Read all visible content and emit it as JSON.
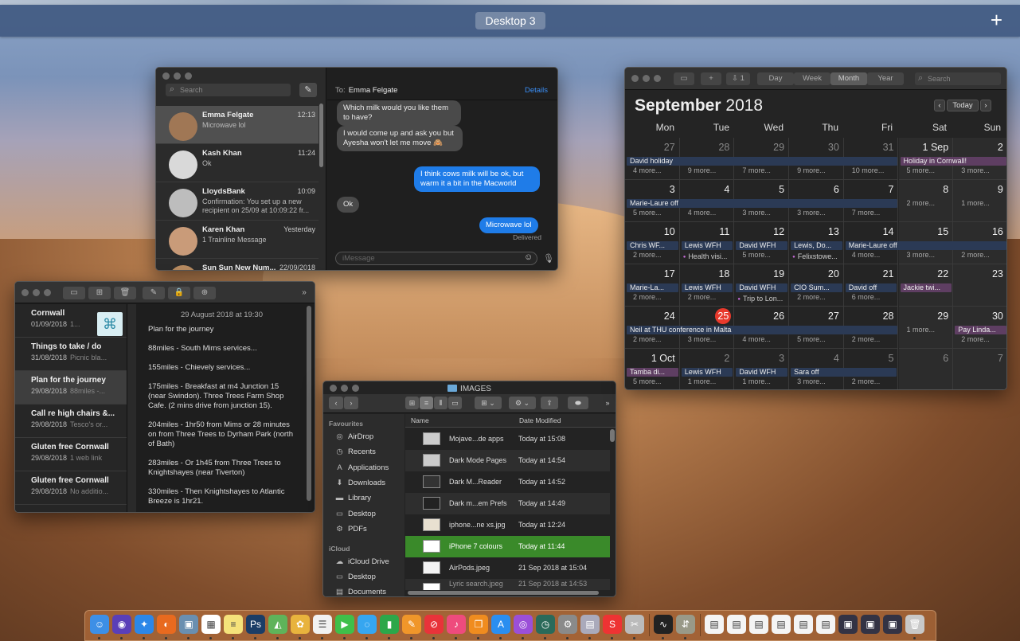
{
  "mission_control": {
    "desktop_label": "Desktop 3",
    "add_label": "+"
  },
  "messages": {
    "search_placeholder": "Search",
    "to_label": "To:",
    "to_name": "Emma Felgate",
    "details": "Details",
    "conversations": [
      {
        "name": "Emma Felgate",
        "time": "12:13",
        "preview": "Microwave lol"
      },
      {
        "name": "Kash Khan",
        "time": "11:24",
        "preview": "Ok"
      },
      {
        "name": "LloydsBank",
        "time": "10:09",
        "preview": "Confirmation: You set up a new recipient on 25/09 at 10:09:22 fr..."
      },
      {
        "name": "Karen Khan",
        "time": "Yesterday",
        "preview": "1 Trainline Message"
      },
      {
        "name": "Sun Sun New Num...",
        "time": "22/09/2018",
        "preview": ""
      }
    ],
    "bubbles": [
      {
        "dir": "in",
        "text": "Which milk would you like them to have?"
      },
      {
        "dir": "in",
        "text": "I would come up and ask you but Ayesha won't let me move 🙈"
      },
      {
        "dir": "out",
        "text": "I think cows milk will be ok, but warm it a bit in the Macworld"
      },
      {
        "dir": "in",
        "text": "Ok"
      },
      {
        "dir": "out",
        "text": "Microwave lol"
      }
    ],
    "delivered": "Delivered",
    "input_placeholder": "iMessage"
  },
  "notes": {
    "items": [
      {
        "title": "Cornwall",
        "date": "01/09/2018",
        "snippet": "1..."
      },
      {
        "title": "Things to take / do",
        "date": "31/08/2018",
        "snippet": "Picnic bla..."
      },
      {
        "title": "Plan for the journey",
        "date": "29/08/2018",
        "snippet": "88miles -..."
      },
      {
        "title": "Call re high chairs &...",
        "date": "29/08/2018",
        "snippet": "Tesco's or..."
      },
      {
        "title": "Gluten free Cornwall",
        "date": "29/08/2018",
        "snippet": "1 web link"
      },
      {
        "title": "Gluten free Cornwall",
        "date": "29/08/2018",
        "snippet": "No additio..."
      }
    ],
    "date": "29 August 2018 at 19:30",
    "paragraphs": [
      "Plan for the journey",
      "88miles - South Mims services...",
      "155miles - Chievely services...",
      "175miles - Breakfast at m4 Junction 15 (near Swindon). Three Trees Farm Shop Cafe. (2 mins drive from junction 15).",
      "204miles - 1hr50 from Mims or 28 minutes on from Three Trees to Dyrham Park (north of Bath)",
      "283miles - Or 1h45 from Three Trees to Knightshayes (near Tiverton)",
      "330miles - Then Knightshayes to Atlantic Breeze is 1hr21."
    ]
  },
  "finder": {
    "title": "IMAGES",
    "favourites_label": "Favourites",
    "favourites": [
      "AirDrop",
      "Recents",
      "Applications",
      "Downloads",
      "Library",
      "Desktop",
      "PDFs"
    ],
    "icloud_label": "iCloud",
    "icloud": [
      "iCloud Drive",
      "Desktop",
      "Documents"
    ],
    "col_name": "Name",
    "col_date": "Date Modified",
    "files": [
      {
        "name": "Mojave...de apps",
        "date": "Today at 15:08"
      },
      {
        "name": "Dark Mode Pages",
        "date": "Today at 14:54"
      },
      {
        "name": "Dark M...Reader",
        "date": "Today at 14:52"
      },
      {
        "name": "Dark m...em Prefs",
        "date": "Today at 14:49"
      },
      {
        "name": "iphone...ne xs.jpg",
        "date": "Today at 12:24"
      },
      {
        "name": "iPhone 7 colours",
        "date": "Today at 11:44"
      },
      {
        "name": "AirPods.jpeg",
        "date": "21 Sep 2018 at 15:04"
      },
      {
        "name": "Lyric search.jpeg",
        "date": "21 Sep 2018 at 14:53"
      }
    ]
  },
  "calendar": {
    "month": "September",
    "year": "2018",
    "views": [
      "Day",
      "Week",
      "Month",
      "Year"
    ],
    "active_view": "Month",
    "search_placeholder": "Search",
    "today_label": "Today",
    "badge": "1",
    "weekdays": [
      "Mon",
      "Tue",
      "Wed",
      "Thu",
      "Fri",
      "Sat",
      "Sun"
    ],
    "weeks": [
      [
        "27",
        "28",
        "29",
        "30",
        "31",
        "1 Sep",
        "2"
      ],
      [
        "3",
        "4",
        "5",
        "6",
        "7",
        "8",
        "9"
      ],
      [
        "10",
        "11",
        "12",
        "13",
        "14",
        "15",
        "16"
      ],
      [
        "17",
        "18",
        "19",
        "20",
        "21",
        "22",
        "23"
      ],
      [
        "24",
        "25",
        "26",
        "27",
        "28",
        "29",
        "30"
      ],
      [
        "1 Oct",
        "2",
        "3",
        "4",
        "5",
        "6",
        "7"
      ]
    ],
    "today_text": "25",
    "events": {
      "david_holiday": "David holiday",
      "holiday_cornwall": "Holiday in Cornwall!",
      "marie_laure_off": "Marie-Laure off",
      "chris_wf": "Chris WF...",
      "lewis_wfh": "Lewis WFH",
      "david_wfh": "David WFH",
      "lewis_do": "Lewis, Do...",
      "marie_laure_off2": "Marie-Laure off",
      "health_visit": "Health visi...",
      "felixstowe": "Felixstowe...",
      "marie_la": "Marie-La...",
      "cio_sum": "CIO Sum...",
      "david_off": "David off",
      "jackie": "Jackie twi...",
      "trip_london": "Trip to Lon...",
      "neil": "Neil at THU conference in Malta",
      "pay_linda": "Pay Linda...",
      "tamba": "Tamba di...",
      "sara_off": "Sara off"
    },
    "more": {
      "w1": [
        "4 more...",
        "9 more...",
        "7 more...",
        "9 more...",
        "10 more...",
        "5 more...",
        "3 more..."
      ],
      "w2": [
        "5 more...",
        "4 more...",
        "3 more...",
        "3 more...",
        "7 more...",
        "2 more...",
        "1 more..."
      ],
      "w3": [
        "2 more...",
        "5 more...",
        "4 more...",
        "3 more...",
        "2 more..."
      ],
      "w4": [
        "2 more...",
        "2 more...",
        "2 more...",
        "6 more..."
      ],
      "w5": [
        "2 more...",
        "3 more...",
        "4 more...",
        "5 more...",
        "2 more...",
        "1 more...",
        "2 more..."
      ],
      "w6": [
        "5 more...",
        "1 more...",
        "1 more...",
        "3 more...",
        "2 more..."
      ]
    }
  }
}
